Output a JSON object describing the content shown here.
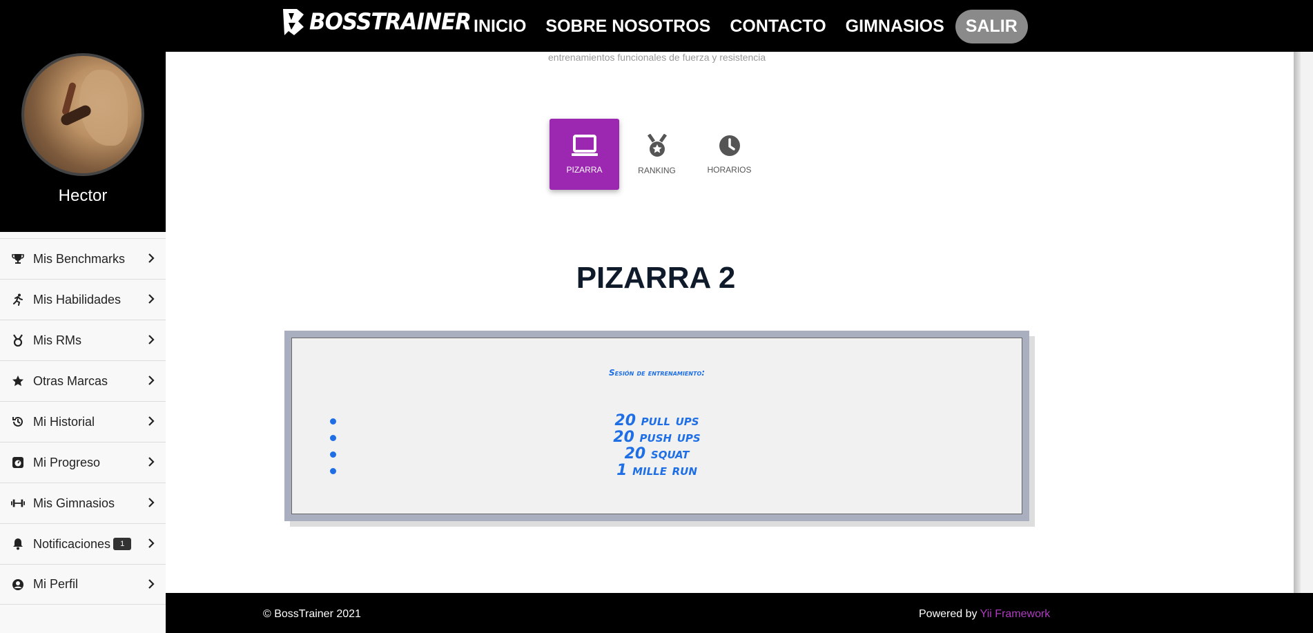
{
  "navbar": {
    "brand": "BOSSTRAINER",
    "links": [
      "INICIO",
      "SOBRE NOSOTROS",
      "CONTACTO",
      "GIMNASIOS"
    ],
    "logout": "SALIR"
  },
  "profile": {
    "name": "Hector"
  },
  "sidebar": {
    "items": [
      {
        "label": "Mis Benchmarks",
        "icon": "trophy-icon"
      },
      {
        "label": "Mis Habilidades",
        "icon": "running-icon"
      },
      {
        "label": "Mis RMs",
        "icon": "medal-icon"
      },
      {
        "label": "Otras Marcas",
        "icon": "star-icon"
      },
      {
        "label": "Mi Historial",
        "icon": "history-icon"
      },
      {
        "label": "Mi Progreso",
        "icon": "progress-icon"
      },
      {
        "label": "Mis Gimnasios",
        "icon": "dumbbell-icon"
      },
      {
        "label": "Notificaciones",
        "icon": "bell-icon",
        "badge": "1"
      },
      {
        "label": "Mi Perfil",
        "icon": "user-circle-icon"
      }
    ]
  },
  "main": {
    "subtitle": "entrenamientos funcionales de fuerza y resistencia",
    "tabs": [
      {
        "label": "PIZARRA",
        "icon": "laptop-icon",
        "active": true
      },
      {
        "label": "RANKING",
        "icon": "medal-icon",
        "active": false
      },
      {
        "label": "HORARIOS",
        "icon": "clock-icon",
        "active": false
      }
    ],
    "title": "PIZARRA 2",
    "board": {
      "session_label": "Sesión de entrenamiento:",
      "exercises": [
        "20 pull ups",
        "20 push ups",
        "20 squat",
        "1 mille run"
      ]
    }
  },
  "footer": {
    "copyright": "© BossTrainer 2021",
    "powered_prefix": "Powered by ",
    "powered_link": "Yii Framework"
  },
  "colors": {
    "accent": "#9c27b0",
    "board_text": "#1e6fe6",
    "navbar": "#000000"
  }
}
